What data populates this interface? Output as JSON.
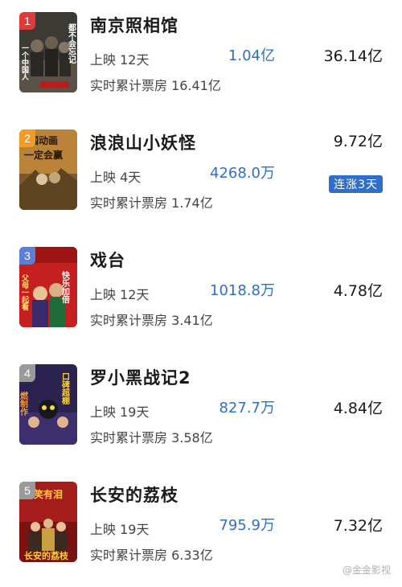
{
  "accent_color": "#2f6ec9",
  "films": [
    {
      "rank": "1",
      "rank_color": "#e03a3a",
      "title": "南京照相馆",
      "days": "上映 12天",
      "total": "实时累计票房 16.41亿",
      "today": "1.04亿",
      "cumulative": "36.14亿",
      "badge": "",
      "poster_text": [
        "都不会忘记",
        "一个中国人"
      ]
    },
    {
      "rank": "2",
      "rank_color": "#f29b27",
      "title": "浪浪山小妖怪",
      "days": "上映 4天",
      "total": "实时累计票房 1.74亿",
      "today": "4268.0万",
      "cumulative": "9.72亿",
      "badge": "连涨3天",
      "poster_text": [
        "国动画",
        "一定会赢"
      ]
    },
    {
      "rank": "3",
      "rank_color": "#5b7fd6",
      "title": "戏台",
      "days": "上映 12天",
      "total": "实时累计票房 3.41亿",
      "today": "1018.8万",
      "cumulative": "4.78亿",
      "badge": "",
      "poster_text": [
        "快乐加倍",
        "父母一起看"
      ]
    },
    {
      "rank": "4",
      "rank_color": "#9a9a9a",
      "title": "罗小黑战记2",
      "days": "上映 19天",
      "total": "实时累计票房 3.58亿",
      "today": "827.7万",
      "cumulative": "4.84亿",
      "badge": "",
      "poster_text": [
        "口碑超棚",
        "燃制作"
      ]
    },
    {
      "rank": "5",
      "rank_color": "#9a9a9a",
      "title": "长安的荔枝",
      "days": "上映 19天",
      "total": "实时累计票房 6.33亿",
      "today": "795.9万",
      "cumulative": "7.32亿",
      "badge": "",
      "poster_text": [
        "有笑有泪",
        "长安的荔枝"
      ]
    }
  ],
  "watermark": "@金金影视"
}
